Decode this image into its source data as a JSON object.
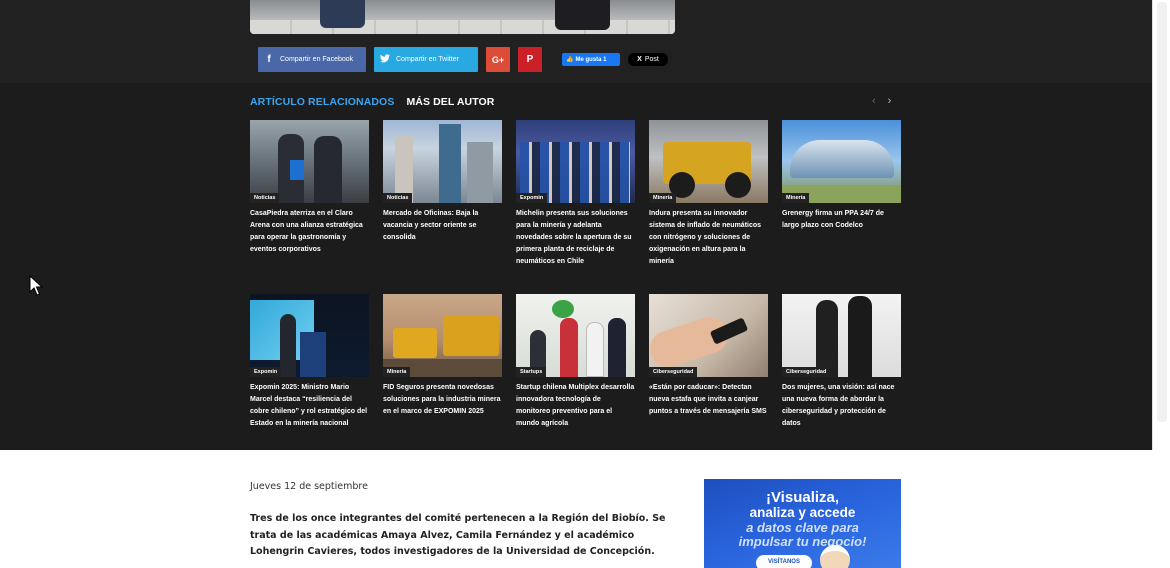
{
  "share": {
    "facebook": "Compartir en Facebook",
    "twitter": "Compartir en Twitter",
    "gplus": "G+",
    "pinterest": "P",
    "like": "Me gusta 1",
    "post": "Post",
    "post_icon": "X"
  },
  "related": {
    "tab_active": "ARTÍCULO RELACIONADOS",
    "tab_other": "MÁS DEL AUTOR",
    "prev": "‹",
    "next": "›",
    "cards": [
      {
        "category": "Noticias",
        "title": "CasaPiedra aterriza en el Claro Arena con una alianza estratégica para operar la gastronomía y eventos corporativos"
      },
      {
        "category": "Noticias",
        "title": "Mercado de Oficinas: Baja la vacancia y sector oriente se consolida"
      },
      {
        "category": "Expomin",
        "title": "Michelin presenta sus soluciones para la minería y adelanta novedades sobre la apertura de su primera planta de reciclaje de neumáticos en Chile"
      },
      {
        "category": "Minería",
        "title": "Indura presenta su innovador sistema de inflado de neumáticos con nitrógeno y soluciones de oxigenación en altura para la minería"
      },
      {
        "category": "Minería",
        "title": "Grenergy firma un PPA 24/7 de largo plazo con Codelco"
      },
      {
        "category": "Expomin",
        "title": "Expomin 2025: Ministro Mario Marcel destaca “resiliencia del cobre chileno” y rol estratégico del Estado en la minería nacional"
      },
      {
        "category": "Minería",
        "title": "FID Seguros presenta novedosas soluciones para la industria minera en el marco de EXPOMIN 2025"
      },
      {
        "category": "Startups",
        "title": "Startup chilena Multiplex desarrolla innovadora tecnología de monitoreo preventivo para el mundo agrícola"
      },
      {
        "category": "Ciberseguridad",
        "title": "«Están por caducar»: Detectan nueva estafa que invita a canjear puntos a través de mensajería SMS"
      },
      {
        "category": "Ciberseguridad",
        "title": "Dos mujeres, una visión: así nace una nueva forma de abordar la ciberseguridad y protección de datos"
      }
    ]
  },
  "article": {
    "date": "Jueves 12 de septiembre",
    "lead": "Tres de los once integrantes del comité pertenecen a la Región del Biobío. Se trata de las académicas Amaya Alvez, Camila Fernández y el académico Lohengrin Cavieres, todos investigadores de la Universidad de Concepción."
  },
  "ad": {
    "line1": "¡Visualiza,",
    "line2": "analiza y accede",
    "line3": "a datos clave para",
    "line4": "impulsar tu negocio!",
    "cta": "VISÍTANOS"
  },
  "colors": {
    "accent": "#3ba4ef",
    "dark_bg": "#212121",
    "facebook": "#4a68a8",
    "twitter": "#29a9e1",
    "gplus": "#dd4b39",
    "pinterest": "#cb2027"
  }
}
